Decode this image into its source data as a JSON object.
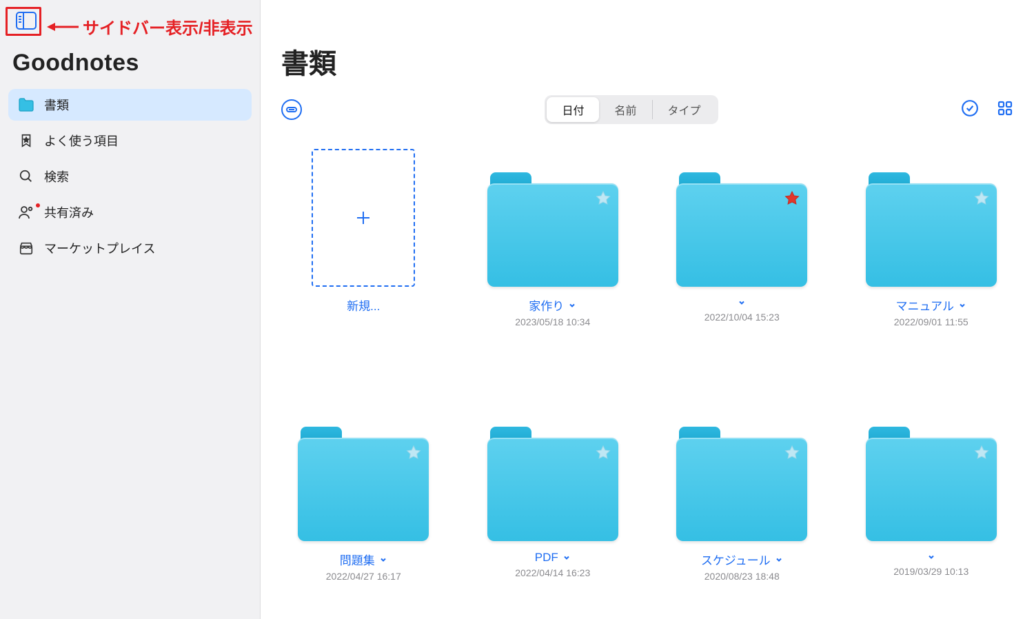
{
  "annotation": {
    "text": "サイドバー表示/非表示"
  },
  "brand": "Goodnotes",
  "sidebar": {
    "items": [
      {
        "label": "書類",
        "active": true
      },
      {
        "label": "よく使う項目",
        "active": false
      },
      {
        "label": "検索",
        "active": false
      },
      {
        "label": "共有済み",
        "active": false,
        "dot": true
      },
      {
        "label": "マーケットプレイス",
        "active": false
      }
    ]
  },
  "page": {
    "title": "書類"
  },
  "sort": {
    "options": [
      "日付",
      "名前",
      "タイプ"
    ],
    "selected": "日付"
  },
  "new_label": "新規...",
  "folders": [
    {
      "name": "家作り",
      "date": "2023/05/18 10:34",
      "starred": false
    },
    {
      "name": "",
      "date": "2022/10/04 15:23",
      "starred": true
    },
    {
      "name": "マニュアル",
      "date": "2022/09/01 11:55",
      "starred": false
    },
    {
      "name": "問題集",
      "date": "2022/04/27 16:17",
      "starred": false
    },
    {
      "name": "PDF",
      "date": "2022/04/14 16:23",
      "starred": false
    },
    {
      "name": "スケジュール",
      "date": "2020/08/23 18:48",
      "starred": false
    },
    {
      "name": "",
      "date": "2019/03/29 10:13",
      "starred": false
    }
  ]
}
